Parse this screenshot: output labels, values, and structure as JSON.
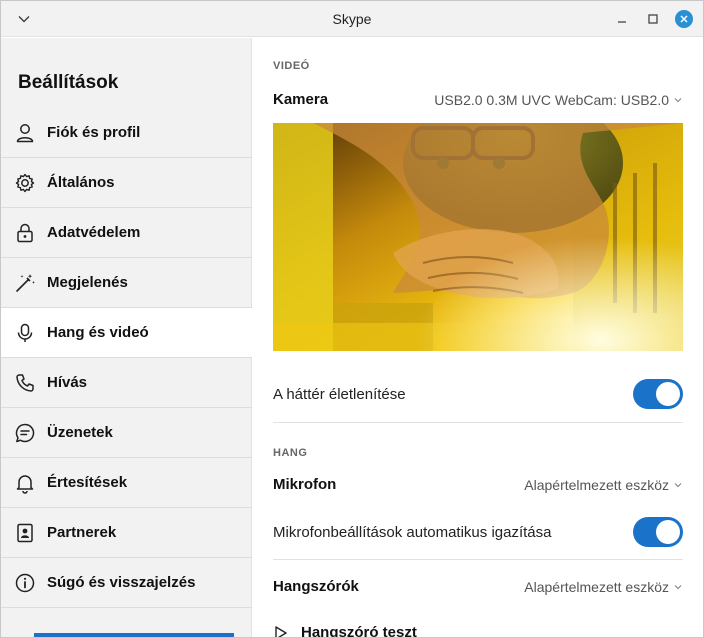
{
  "window": {
    "title": "Skype",
    "accent_color": "#1a73c9",
    "close_color": "#2b8fd6"
  },
  "sidebar": {
    "title": "Beállítások",
    "items": [
      {
        "label": "Fiók és profil",
        "icon": "person-icon",
        "active": false
      },
      {
        "label": "Általános",
        "icon": "gear-icon",
        "active": false
      },
      {
        "label": "Adatvédelem",
        "icon": "lock-icon",
        "active": false
      },
      {
        "label": "Megjelenés",
        "icon": "magic-wand-icon",
        "active": false
      },
      {
        "label": "Hang és videó",
        "icon": "microphone-icon",
        "active": true
      },
      {
        "label": "Hívás",
        "icon": "phone-icon",
        "active": false
      },
      {
        "label": "Üzenetek",
        "icon": "chat-bubble-icon",
        "active": false
      },
      {
        "label": "Értesítések",
        "icon": "bell-icon",
        "active": false
      },
      {
        "label": "Partnerek",
        "icon": "contact-card-icon",
        "active": false
      },
      {
        "label": "Súgó és visszajelzés",
        "icon": "info-icon",
        "active": false
      }
    ]
  },
  "video": {
    "section_title": "VIDEÓ",
    "camera_label": "Kamera",
    "camera_value": "USB2.0 0.3M UVC WebCam: USB2.0",
    "background_blur_label": "A háttér életlenítése",
    "background_blur_on": true
  },
  "audio": {
    "section_title": "HANG",
    "microphone_label": "Mikrofon",
    "microphone_value": "Alapértelmezett eszköz",
    "auto_adjust_label": "Mikrofonbeállítások automatikus igazítása",
    "auto_adjust_on": true,
    "speakers_label": "Hangszórók",
    "speakers_value": "Alapértelmezett eszköz",
    "cut_label": "Hangszóró teszt"
  }
}
